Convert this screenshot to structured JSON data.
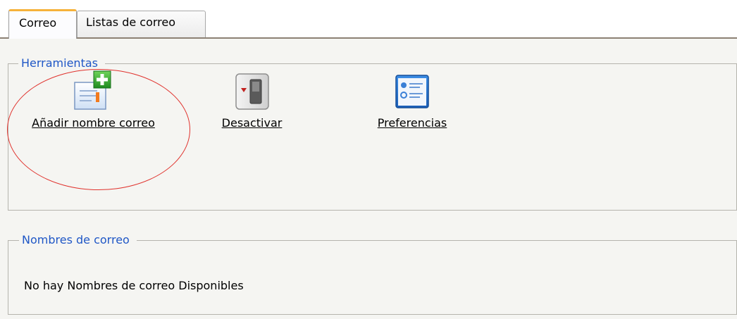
{
  "tabs": [
    {
      "label": "Correo",
      "active": true
    },
    {
      "label": "Listas de correo",
      "active": false
    }
  ],
  "tools_section": {
    "legend": "Herramientas",
    "items": [
      {
        "label": "Añadir nombre correo",
        "icon": "add-mail-icon"
      },
      {
        "label": "Desactivar",
        "icon": "toggle-switch-icon"
      },
      {
        "label": "Preferencias",
        "icon": "preferences-icon"
      }
    ]
  },
  "names_section": {
    "legend": "Nombres de correo",
    "empty_message": "No hay Nombres de correo Disponibles"
  },
  "colors": {
    "legend_text": "#1f57c6",
    "active_tab_accent": "#f6b23b",
    "highlight_circle": "#e0322d"
  }
}
